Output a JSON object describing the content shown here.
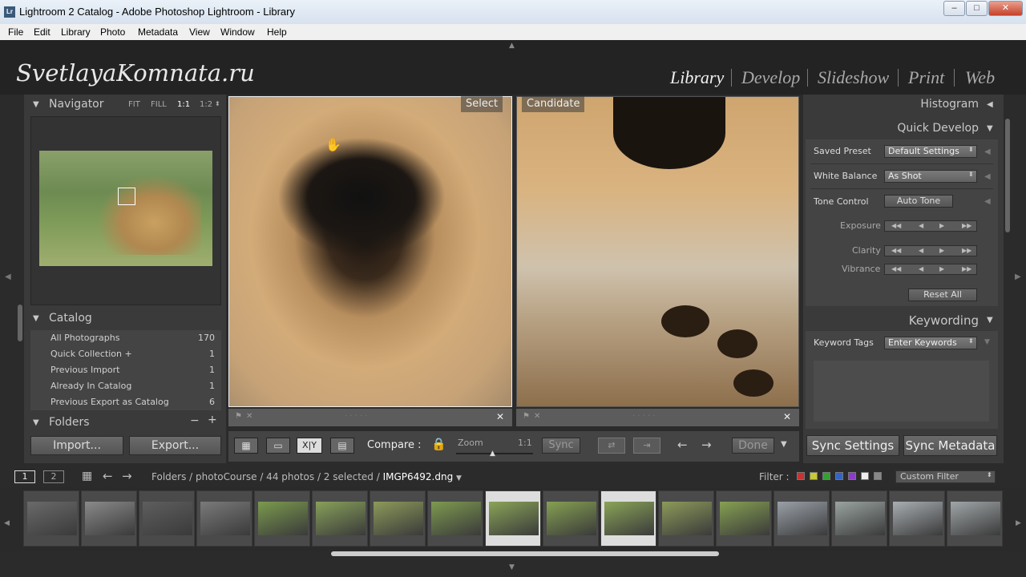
{
  "window": {
    "title": "Lightroom 2 Catalog - Adobe Photoshop Lightroom - Library",
    "logo": "Lr"
  },
  "menu": [
    "File",
    "Edit",
    "Library",
    "Photo",
    "Metadata",
    "View",
    "Window",
    "Help"
  ],
  "brand": "SvetlayaKomnata.ru",
  "modules": [
    "Library",
    "Develop",
    "Slideshow",
    "Print",
    "Web"
  ],
  "navigator": {
    "title": "Navigator",
    "zoom_options": [
      "FIT",
      "FILL",
      "1:1",
      "1:2"
    ]
  },
  "catalog": {
    "title": "Catalog",
    "items": [
      {
        "label": "All Photographs",
        "count": "170"
      },
      {
        "label": "Quick Collection  +",
        "count": "1"
      },
      {
        "label": "Previous Import",
        "count": "1"
      },
      {
        "label": "Already In Catalog",
        "count": "1"
      },
      {
        "label": "Previous Export as Catalog",
        "count": "6"
      }
    ]
  },
  "folders": {
    "title": "Folders"
  },
  "left_buttons": {
    "import": "Import...",
    "export": "Export..."
  },
  "compare": {
    "select_label": "Select",
    "candidate_label": "Candidate",
    "compare_label": "Compare :",
    "zoom_label": "Zoom",
    "zoom_value": "1:1",
    "sync_label": "Sync",
    "done_label": "Done",
    "xy": "X|Y"
  },
  "right": {
    "histogram": "Histogram",
    "quick_develop": "Quick Develop",
    "saved_preset_label": "Saved Preset",
    "saved_preset_value": "Default Settings",
    "white_balance_label": "White Balance",
    "white_balance_value": "As Shot",
    "tone_control_label": "Tone Control",
    "auto_tone": "Auto Tone",
    "exposure": "Exposure",
    "clarity": "Clarity",
    "vibrance": "Vibrance",
    "reset_all": "Reset All",
    "keywording": "Keywording",
    "keyword_tags_label": "Keyword Tags",
    "keyword_tags_value": "Enter Keywords",
    "sync_settings": "Sync Settings",
    "sync_metadata": "Sync Metadata"
  },
  "filmstrip": {
    "page1": "1",
    "page2": "2",
    "path": "Folders / photoCourse / 44 photos / 2 selected /",
    "filename": "IMGP6492.dng",
    "filter_label": "Filter :",
    "custom_filter": "Custom Filter",
    "filter_colors": [
      "#c83232",
      "#c8c832",
      "#32a032",
      "#3264c8",
      "#8c3cc8",
      "#eeeeee",
      "#888888"
    ]
  }
}
